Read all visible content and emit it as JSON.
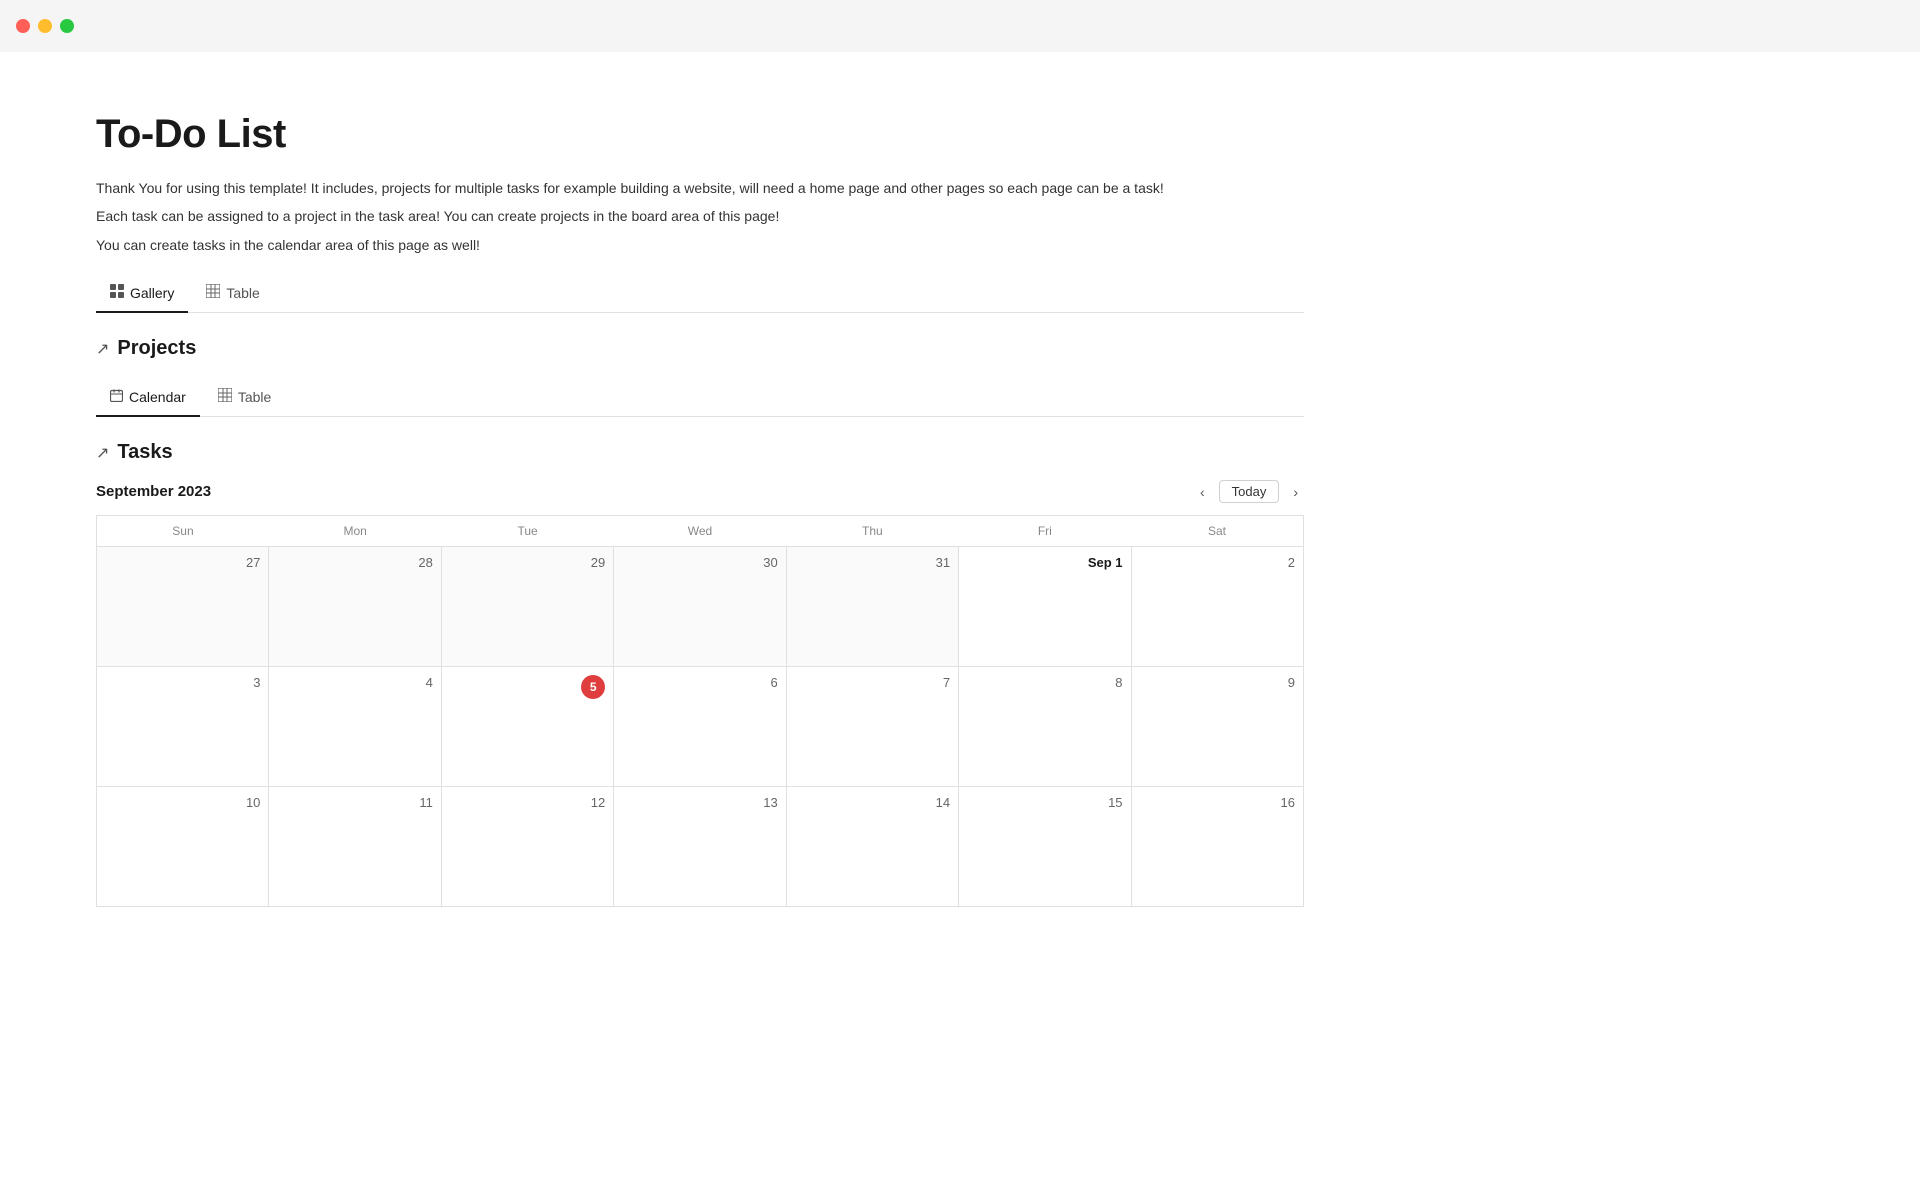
{
  "window": {
    "traffic_close": "close",
    "traffic_minimize": "minimize",
    "traffic_maximize": "maximize"
  },
  "page": {
    "title": "To-Do List",
    "descriptions": [
      "Thank You for using this template! It includes, projects for multiple tasks for example building a website, will need a home page and other pages so each page can be a task!",
      "Each task can be assigned to a project in the task area! You can create projects in the board area of this page!",
      "You can create tasks in the calendar area of this page as well!"
    ]
  },
  "top_tabs": [
    {
      "id": "gallery",
      "label": "Gallery",
      "icon": "⊞",
      "active": true
    },
    {
      "id": "table",
      "label": "Table",
      "icon": "⊟",
      "active": false
    }
  ],
  "projects_section": {
    "title": "Projects",
    "arrow": "↗",
    "tabs": [
      {
        "id": "calendar",
        "label": "Calendar",
        "icon": "◻",
        "active": true
      },
      {
        "id": "table",
        "label": "Table",
        "icon": "⊟",
        "active": false
      }
    ]
  },
  "tasks_section": {
    "title": "Tasks",
    "arrow": "↗"
  },
  "calendar": {
    "month_title": "September 2023",
    "nav_prev": "‹",
    "nav_next": "›",
    "today_label": "Today",
    "day_headers": [
      "Sun",
      "Mon",
      "Tue",
      "Wed",
      "Thu",
      "Fri",
      "Sat"
    ],
    "weeks": [
      [
        {
          "day": "27",
          "outside": true
        },
        {
          "day": "28",
          "outside": true
        },
        {
          "day": "29",
          "outside": true
        },
        {
          "day": "30",
          "outside": true
        },
        {
          "day": "31",
          "outside": true
        },
        {
          "day": "Sep 1",
          "outside": false,
          "first": true
        },
        {
          "day": "2",
          "outside": false
        }
      ],
      [
        {
          "day": "3",
          "outside": false
        },
        {
          "day": "4",
          "outside": false
        },
        {
          "day": "5",
          "outside": false,
          "today": true
        },
        {
          "day": "6",
          "outside": false
        },
        {
          "day": "7",
          "outside": false
        },
        {
          "day": "8",
          "outside": false
        },
        {
          "day": "9",
          "outside": false
        }
      ],
      [
        {
          "day": "10",
          "outside": false
        },
        {
          "day": "11",
          "outside": false
        },
        {
          "day": "12",
          "outside": false
        },
        {
          "day": "13",
          "outside": false
        },
        {
          "day": "14",
          "outside": false
        },
        {
          "day": "15",
          "outside": false
        },
        {
          "day": "16",
          "outside": false
        }
      ]
    ]
  }
}
